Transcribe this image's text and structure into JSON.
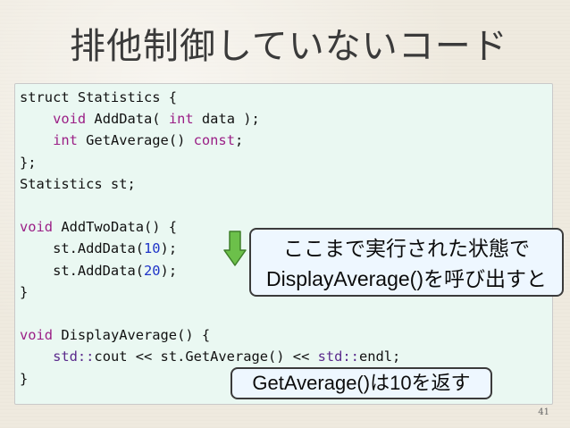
{
  "slide": {
    "title": "排他制御していないコード",
    "page_number": "41",
    "code": {
      "lines": [
        [
          "struct Statistics {"
        ],
        [
          "    ",
          "void",
          " AddData( ",
          "int",
          " data );"
        ],
        [
          "    ",
          "int",
          " GetAverage() ",
          "const",
          ";"
        ],
        [
          "};"
        ],
        [
          "Statistics st;"
        ],
        [
          ""
        ],
        [
          "void",
          " AddTwoData() {"
        ],
        [
          "    st.AddData(",
          "10",
          ");"
        ],
        [
          "    st.AddData(",
          "20",
          ");"
        ],
        [
          "}"
        ],
        [
          ""
        ],
        [
          "void",
          " DisplayAverage() {"
        ],
        [
          "    ",
          "std::",
          "cout << st.GetAverage() << ",
          "std::",
          "endl;"
        ],
        [
          "}"
        ]
      ]
    },
    "callout_state": {
      "line1": "ここまで実行された状態で",
      "line2": "DisplayAverage()を呼び出すと"
    },
    "callout_result": {
      "text": "GetAverage()は10を返す"
    },
    "arrow": {
      "icon": "down-arrow-icon",
      "fill": "#6cc04a",
      "stroke": "#3f7f2a"
    },
    "colors": {
      "code_background": "#eaf8f2",
      "keyword": "#9b1f86",
      "number": "#1f34c8",
      "namespace": "#5a2a8c",
      "callout_background": "#eef7ff"
    }
  }
}
